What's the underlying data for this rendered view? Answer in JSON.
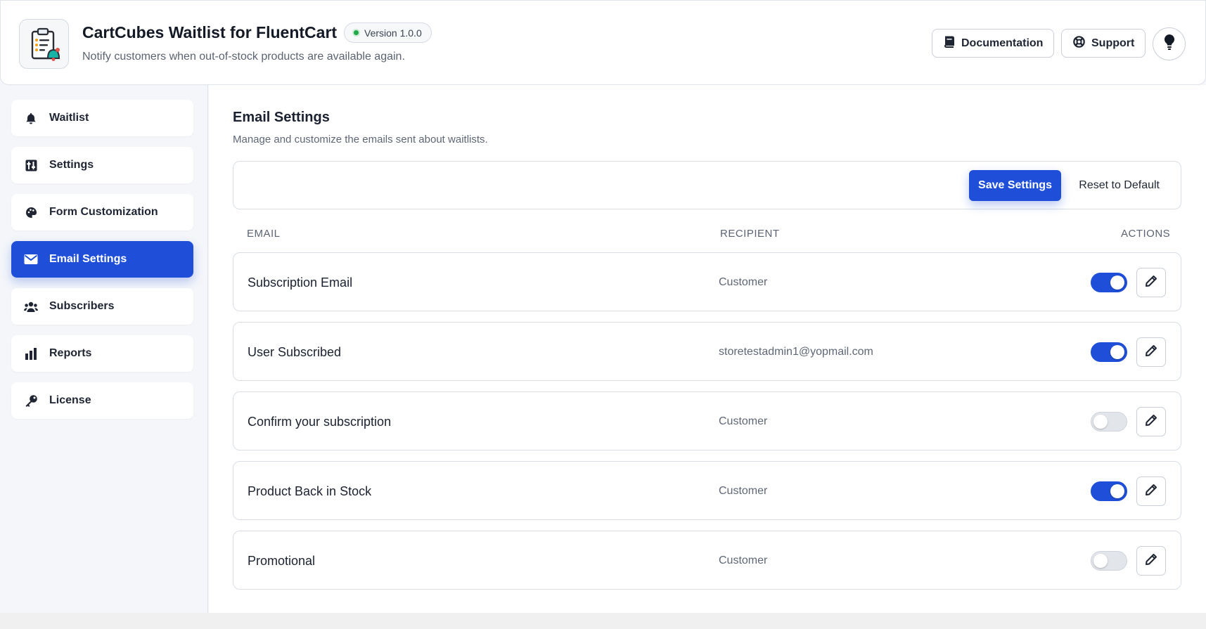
{
  "header": {
    "title": "CartCubes Waitlist for FluentCart",
    "version": "Version 1.0.0",
    "subtitle": "Notify customers when out-of-stock products are available again.",
    "documentation_label": "Documentation",
    "support_label": "Support",
    "logo_icon": "clipboard-bell-icon",
    "theme_icon": "lightbulb-icon"
  },
  "sidebar": {
    "items": [
      {
        "label": "Waitlist",
        "icon": "bell-icon",
        "active": false
      },
      {
        "label": "Settings",
        "icon": "sliders-icon",
        "active": false
      },
      {
        "label": "Form Customization",
        "icon": "palette-icon",
        "active": false
      },
      {
        "label": "Email Settings",
        "icon": "envelope-icon",
        "active": true
      },
      {
        "label": "Subscribers",
        "icon": "users-icon",
        "active": false
      },
      {
        "label": "Reports",
        "icon": "bar-chart-icon",
        "active": false
      },
      {
        "label": "License",
        "icon": "key-icon",
        "active": false
      }
    ]
  },
  "main": {
    "title": "Email Settings",
    "subtitle": "Manage and customize the emails sent about waitlists.",
    "save_label": "Save Settings",
    "reset_label": "Reset to Default",
    "columns": {
      "email": "EMAIL",
      "recipient": "RECIPIENT",
      "actions": "ACTIONS"
    },
    "rows": [
      {
        "name": "Subscription Email",
        "recipient": "Customer",
        "enabled": true
      },
      {
        "name": "User Subscribed",
        "recipient": "storetestadmin1@yopmail.com",
        "enabled": true
      },
      {
        "name": "Confirm your subscription",
        "recipient": "Customer",
        "enabled": false
      },
      {
        "name": "Product Back in Stock",
        "recipient": "Customer",
        "enabled": true
      },
      {
        "name": "Promotional",
        "recipient": "Customer",
        "enabled": false
      }
    ]
  },
  "colors": {
    "accent": "#1f4fd8",
    "status_green": "#22a84a"
  }
}
